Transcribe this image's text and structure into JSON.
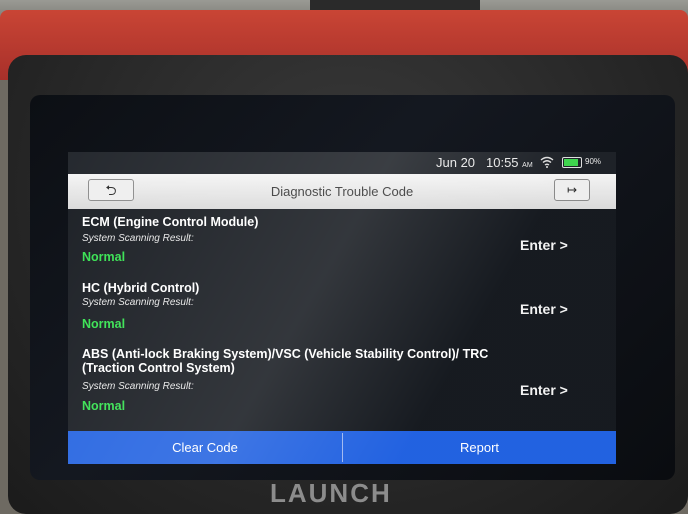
{
  "status_bar": {
    "date": "Jun 20",
    "time": "10:55",
    "ampm": "AM",
    "battery_percent": "90%",
    "battery_level": 0.9,
    "wifi_icon": "wifi-icon"
  },
  "header": {
    "title": "Diagnostic Trouble Code",
    "back_icon": "⮌",
    "exit_icon": "↦"
  },
  "systems": [
    {
      "name": "ECM (Engine Control Module)",
      "result_label": "System Scanning Result:",
      "result": "Normal",
      "action": "Enter >"
    },
    {
      "name": "HC (Hybrid Control)",
      "result_label": "System Scanning Result:",
      "result": "Normal",
      "action": "Enter >"
    },
    {
      "name": "ABS (Anti-lock Braking System)/VSC (Vehicle Stability Control)/ TRC (Traction Control System)",
      "result_label": "System Scanning Result:",
      "result": "Normal",
      "action": "Enter >"
    }
  ],
  "footer": {
    "clear_code": "Clear Code",
    "report": "Report"
  },
  "device": {
    "brand": "LAUNCH"
  },
  "colors": {
    "accent": "#1e5fe0",
    "status_normal": "#2fe04a",
    "device_red": "#c94535"
  }
}
